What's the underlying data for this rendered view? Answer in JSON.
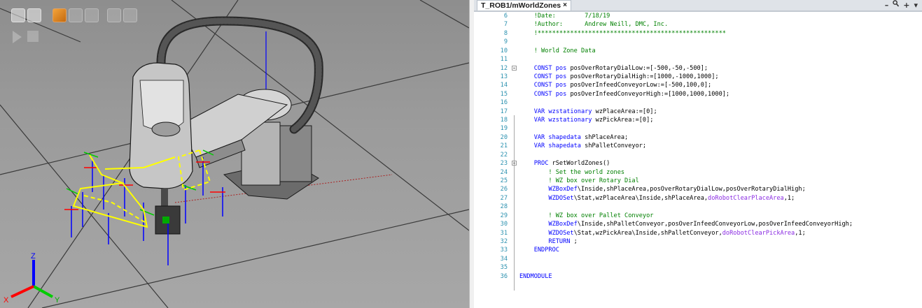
{
  "editor": {
    "tab_title": "T_ROB1/mWorldZones",
    "tab_close": "×",
    "controls": {
      "minimize": "–",
      "find": "🔍",
      "add": "+",
      "menu": "▾"
    },
    "lines": [
      {
        "n": "6",
        "segs": [
          {
            "t": "    !Date:        7/18/19",
            "c": "c-green"
          }
        ]
      },
      {
        "n": "7",
        "segs": [
          {
            "t": "    !Author:      Andrew Neill, DMC, Inc.",
            "c": "c-green"
          }
        ]
      },
      {
        "n": "8",
        "segs": [
          {
            "t": "    !****************************************************",
            "c": "c-green"
          }
        ]
      },
      {
        "n": "9",
        "segs": []
      },
      {
        "n": "10",
        "segs": [
          {
            "t": "    ! World Zone Data",
            "c": "c-green"
          }
        ]
      },
      {
        "n": "11",
        "segs": []
      },
      {
        "n": "12",
        "fold": true,
        "segs": [
          {
            "t": "    CONST pos ",
            "c": "c-blue"
          },
          {
            "t": "posOverRotaryDialLow:=[-500,-50,-500];",
            "c": "c-black"
          }
        ]
      },
      {
        "n": "13",
        "segs": [
          {
            "t": "    CONST pos ",
            "c": "c-blue"
          },
          {
            "t": "posOverRotaryDialHigh:=[1000,-1000,1000];",
            "c": "c-black"
          }
        ]
      },
      {
        "n": "14",
        "segs": [
          {
            "t": "    CONST pos ",
            "c": "c-blue"
          },
          {
            "t": "posOverInfeedConveyorLow:=[-500,100,0];",
            "c": "c-black"
          }
        ]
      },
      {
        "n": "15",
        "segs": [
          {
            "t": "    CONST pos ",
            "c": "c-blue"
          },
          {
            "t": "posOverInfeedConveyorHigh:=[1000,1000,1000];",
            "c": "c-black"
          }
        ]
      },
      {
        "n": "16",
        "segs": []
      },
      {
        "n": "17",
        "segs": [
          {
            "t": "    VAR wzstationary ",
            "c": "c-blue"
          },
          {
            "t": "wzPlaceArea:=[0];",
            "c": "c-black"
          }
        ]
      },
      {
        "n": "18",
        "segs": [
          {
            "t": "    VAR wzstationary ",
            "c": "c-blue"
          },
          {
            "t": "wzPickArea:=[0];",
            "c": "c-black"
          }
        ]
      },
      {
        "n": "19",
        "segs": []
      },
      {
        "n": "20",
        "segs": [
          {
            "t": "    VAR shapedata ",
            "c": "c-blue"
          },
          {
            "t": "shPlaceArea;",
            "c": "c-black"
          }
        ]
      },
      {
        "n": "21",
        "segs": [
          {
            "t": "    VAR shapedata ",
            "c": "c-blue"
          },
          {
            "t": "shPalletConveyor;",
            "c": "c-black"
          }
        ]
      },
      {
        "n": "22",
        "segs": []
      },
      {
        "n": "23",
        "fold": true,
        "segs": [
          {
            "t": "    PROC ",
            "c": "c-blue"
          },
          {
            "t": "rSetWorldZones()",
            "c": "c-black"
          }
        ]
      },
      {
        "n": "24",
        "segs": [
          {
            "t": "        ! Set the world zones",
            "c": "c-green"
          }
        ]
      },
      {
        "n": "25",
        "segs": [
          {
            "t": "        ! WZ box over Rotary Dial",
            "c": "c-green"
          }
        ]
      },
      {
        "n": "26",
        "segs": [
          {
            "t": "        WZBoxDef",
            "c": "c-blue"
          },
          {
            "t": "\\Inside,shPlaceArea,posOverRotaryDialLow,posOverRotaryDialHigh;",
            "c": "c-black"
          }
        ]
      },
      {
        "n": "27",
        "segs": [
          {
            "t": "        WZDOSet",
            "c": "c-blue"
          },
          {
            "t": "\\Stat,wzPlaceArea\\Inside,shPlaceArea,",
            "c": "c-black"
          },
          {
            "t": "doRobotClearPlaceArea",
            "c": "c-purple"
          },
          {
            "t": ",1;",
            "c": "c-black"
          }
        ]
      },
      {
        "n": "28",
        "segs": []
      },
      {
        "n": "29",
        "segs": [
          {
            "t": "        ! WZ box over Pallet Conveyor",
            "c": "c-green"
          }
        ]
      },
      {
        "n": "30",
        "segs": [
          {
            "t": "        WZBoxDef",
            "c": "c-blue"
          },
          {
            "t": "\\Inside,shPalletConveyor,posOverInfeedConveyorLow,posOverInfeedConveyorHigh;",
            "c": "c-black"
          }
        ]
      },
      {
        "n": "31",
        "segs": [
          {
            "t": "        WZDOSet",
            "c": "c-blue"
          },
          {
            "t": "\\Stat,wzPickArea\\Inside,shPalletConveyor,",
            "c": "c-black"
          },
          {
            "t": "doRobotClearPickArea",
            "c": "c-purple"
          },
          {
            "t": ",1;",
            "c": "c-black"
          }
        ]
      },
      {
        "n": "32",
        "segs": [
          {
            "t": "        RETURN",
            "c": "c-blue"
          },
          {
            "t": " ;",
            "c": "c-black"
          }
        ]
      },
      {
        "n": "33",
        "segs": [
          {
            "t": "    ENDPROC",
            "c": "c-blue"
          }
        ]
      },
      {
        "n": "34",
        "segs": []
      },
      {
        "n": "35",
        "segs": []
      },
      {
        "n": "36",
        "segs": [
          {
            "t": "ENDMODULE",
            "c": "c-blue"
          }
        ]
      }
    ]
  },
  "viewport": {
    "axis_labels": {
      "x": "X",
      "y": "Y",
      "z": "Z"
    },
    "toolbar_icons": [
      "view-icon",
      "grid-icon",
      "select-icon",
      "frame-icon",
      "snap-icon",
      "measure-icon",
      "play-icon",
      "stop-icon"
    ]
  },
  "colors": {
    "comment": "#008000",
    "keyword": "#0000ff",
    "signal": "#8a2be2",
    "line_number": "#2b91af",
    "path": "#ffff00",
    "axis_x": "#ff0000",
    "axis_y": "#00cc00",
    "axis_z": "#0000ff"
  }
}
